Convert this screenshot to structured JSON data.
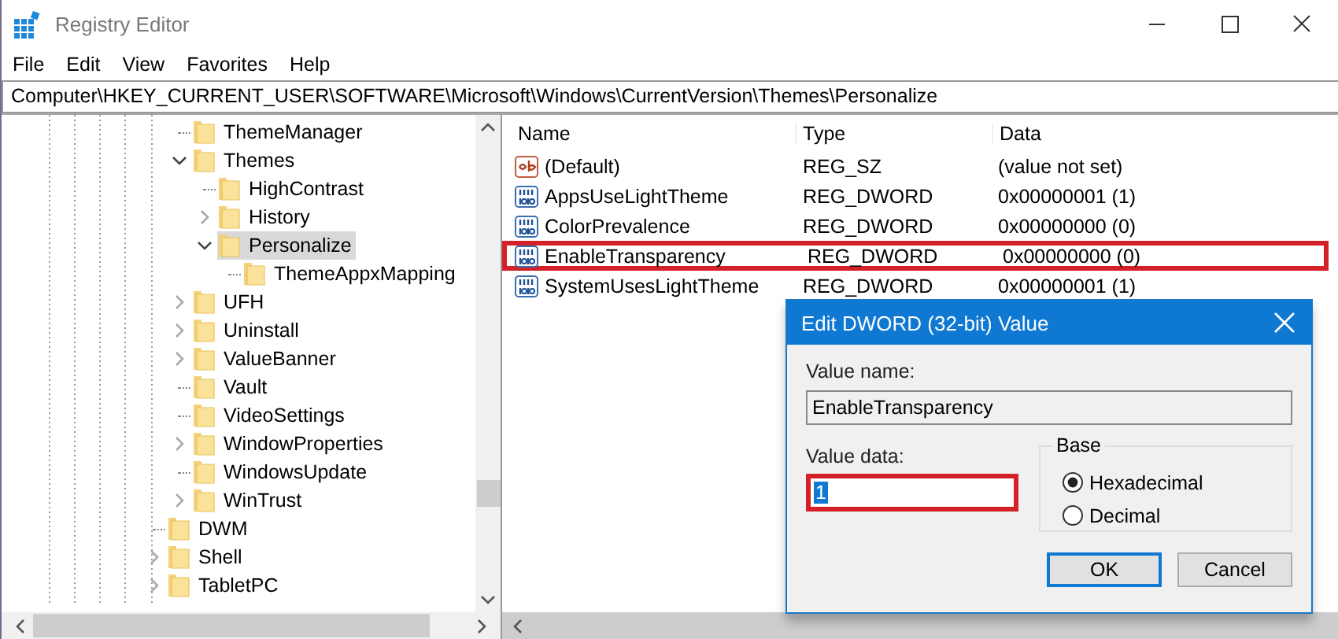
{
  "window": {
    "title": "Registry Editor"
  },
  "menu": [
    "File",
    "Edit",
    "View",
    "Favorites",
    "Help"
  ],
  "address": "Computer\\HKEY_CURRENT_USER\\SOFTWARE\\Microsoft\\Windows\\CurrentVersion\\Themes\\Personalize",
  "tree": [
    {
      "kind": "group",
      "children": [
        {
          "kind": "key",
          "label": "ThemeManager",
          "has_children": false,
          "selected": false
        },
        {
          "kind": "key",
          "label": "Themes",
          "has_children": true,
          "expanded": true,
          "selected": false,
          "children": [
            {
              "kind": "key",
              "label": "HighContrast",
              "has_children": false,
              "selected": false
            },
            {
              "kind": "key",
              "label": "History",
              "has_children": true,
              "expanded": false,
              "selected": false
            },
            {
              "kind": "key",
              "label": "Personalize",
              "has_children": true,
              "expanded": true,
              "selected": true,
              "children": [
                {
                  "kind": "key",
                  "label": "ThemeAppxMapping",
                  "has_children": false,
                  "selected": false
                }
              ]
            }
          ]
        },
        {
          "kind": "key",
          "label": "UFH",
          "has_children": true,
          "expanded": false,
          "selected": false
        },
        {
          "kind": "key",
          "label": "Uninstall",
          "has_children": true,
          "expanded": false,
          "selected": false
        },
        {
          "kind": "key",
          "label": "ValueBanner",
          "has_children": true,
          "expanded": false,
          "selected": false
        },
        {
          "kind": "key",
          "label": "Vault",
          "has_children": false,
          "selected": false
        },
        {
          "kind": "key",
          "label": "VideoSettings",
          "has_children": false,
          "selected": false
        },
        {
          "kind": "key",
          "label": "WindowProperties",
          "has_children": true,
          "expanded": false,
          "selected": false
        },
        {
          "kind": "key",
          "label": "WindowsUpdate",
          "has_children": false,
          "selected": false
        },
        {
          "kind": "key",
          "label": "WinTrust",
          "has_children": true,
          "expanded": false,
          "selected": false
        }
      ]
    },
    {
      "kind": "key",
      "label": "DWM",
      "has_children": false,
      "selected": false
    },
    {
      "kind": "key",
      "label": "Shell",
      "has_children": true,
      "expanded": false,
      "selected": false
    },
    {
      "kind": "key",
      "label": "TabletPC",
      "has_children": true,
      "expanded": false,
      "selected": false
    }
  ],
  "list": {
    "columns": [
      "Name",
      "Type",
      "Data"
    ],
    "rows": [
      {
        "kind": "string",
        "name": "(Default)",
        "type": "REG_SZ",
        "data": "(value not set)",
        "highlighted": false
      },
      {
        "kind": "dword",
        "name": "AppsUseLightTheme",
        "type": "REG_DWORD",
        "data": "0x00000001 (1)",
        "highlighted": false
      },
      {
        "kind": "dword",
        "name": "ColorPrevalence",
        "type": "REG_DWORD",
        "data": "0x00000000 (0)",
        "highlighted": false
      },
      {
        "kind": "dword",
        "name": "EnableTransparency",
        "type": "REG_DWORD",
        "data": "0x00000000 (0)",
        "highlighted": true
      },
      {
        "kind": "dword",
        "name": "SystemUsesLightTheme",
        "type": "REG_DWORD",
        "data": "0x00000001 (1)",
        "highlighted": false
      }
    ]
  },
  "dialog": {
    "title": "Edit DWORD (32-bit) Value",
    "value_name_label": "Value name:",
    "value_name": "EnableTransparency",
    "value_data_label": "Value data:",
    "value_data": "1",
    "value_data_highlighted": true,
    "base": {
      "label": "Base",
      "options": [
        {
          "label": "Hexadecimal",
          "selected": true
        },
        {
          "label": "Decimal",
          "selected": false
        }
      ]
    },
    "buttons": [
      {
        "label": "OK",
        "default": true
      },
      {
        "label": "Cancel",
        "default": false
      }
    ]
  }
}
